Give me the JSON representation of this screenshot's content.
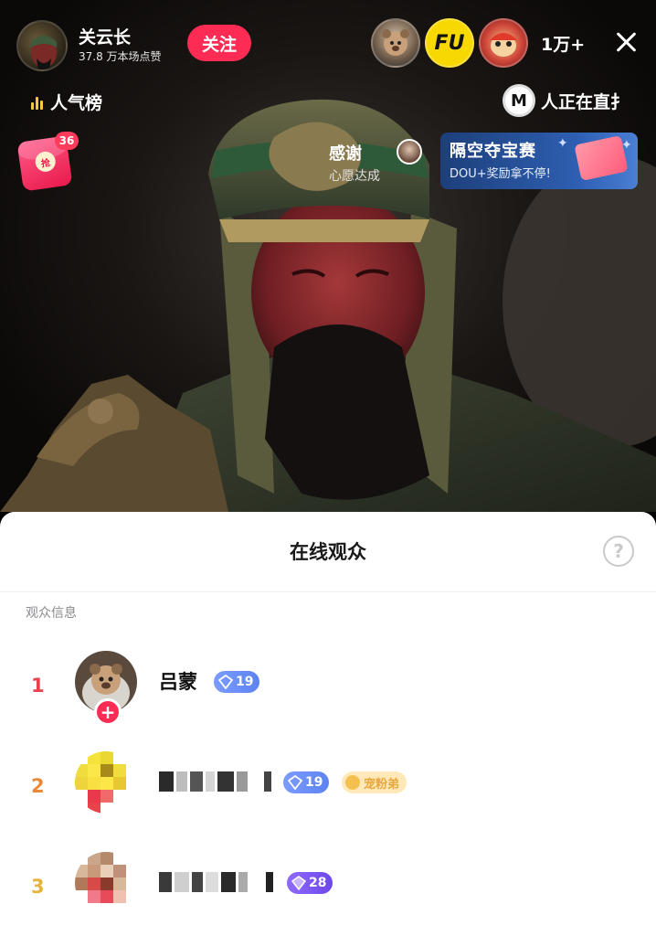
{
  "host": {
    "name": "关云长",
    "likes": "37.8 万本场点赞",
    "follow_label": "关注"
  },
  "topbar": {
    "viewer_count": "1万+",
    "viewer_avatars": [
      "viewer-avatar-bear",
      "viewer-avatar-fu",
      "viewer-avatar-lion"
    ],
    "fu_text": "FU"
  },
  "rank": {
    "label": "人气榜"
  },
  "live_now": {
    "label": "人正在直扌",
    "icon_letter": "M"
  },
  "red_packet": {
    "count": "36",
    "coin_text": "抢"
  },
  "thanks": {
    "title": "感谢",
    "subtitle": "心愿达成"
  },
  "event": {
    "title": "隔空夺宝赛",
    "subtitle": "DOU+奖励拿不停!"
  },
  "sheet": {
    "title": "在线观众",
    "help_symbol": "?",
    "section_label": "观众信息"
  },
  "viewers": [
    {
      "rank": "1",
      "name": "吕蒙",
      "level": "19",
      "level_style": "blue",
      "rank_color": "#e8424f"
    },
    {
      "rank": "2",
      "name": "",
      "level": "19",
      "level_style": "blue",
      "fan_badge": "宠粉弟",
      "rank_color": "#e98a3a"
    },
    {
      "rank": "3",
      "name": "",
      "level": "28",
      "level_style": "purple",
      "rank_color": "#e6b43c"
    }
  ],
  "colors": {
    "accent": "#fe2c55",
    "rank_gold": "#f6c744",
    "level_blue": "#5d83f0",
    "level_purple": "#6e47e8"
  }
}
